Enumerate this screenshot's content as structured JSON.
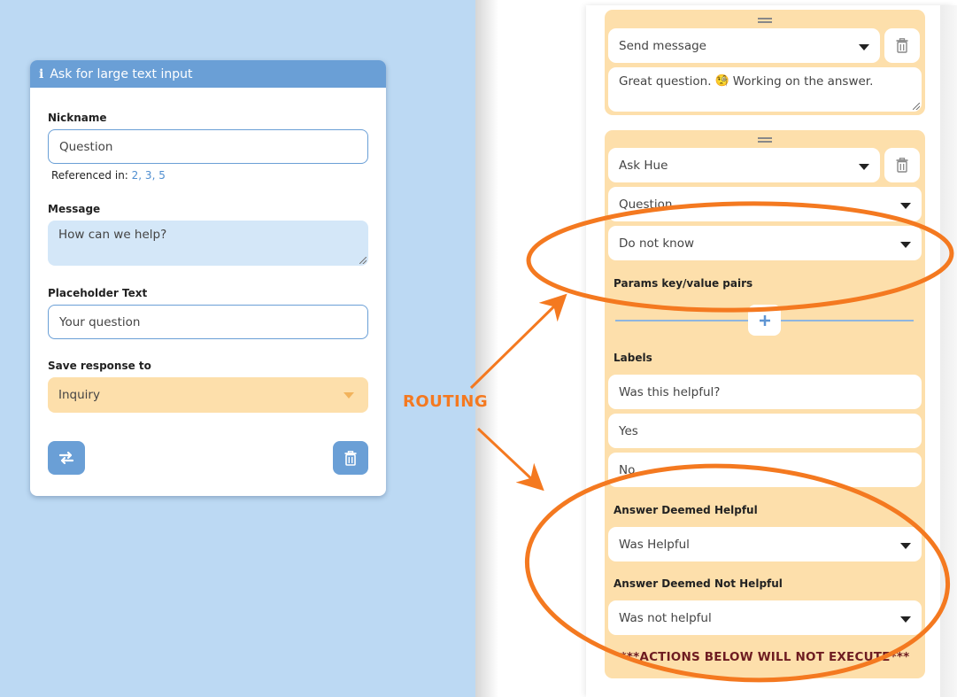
{
  "left_panel": {
    "header": {
      "icon": "info-icon",
      "title": "Ask for large text input"
    },
    "nickname": {
      "label": "Nickname",
      "value": "Question",
      "referenced_in_label": "Referenced in:",
      "referenced_in_values": "2, 3, 5"
    },
    "message": {
      "label": "Message",
      "value": "How can we help?"
    },
    "placeholder_text": {
      "label": "Placeholder Text",
      "value": "Your question"
    },
    "save_response": {
      "label": "Save response to",
      "selected": "Inquiry"
    },
    "buttons": {
      "swap": "swap-arrows-icon",
      "delete": "trash-icon"
    }
  },
  "annotation": {
    "label": "ROUTING",
    "color": "#f47920"
  },
  "right_panel": {
    "send_message_block": {
      "action_select": "Send message",
      "message_text": "Great question.",
      "emoji": "🧐",
      "message_text_after": "Working on the answer."
    },
    "ask_hue_block": {
      "action_select": "Ask Hue",
      "question_select": "Question",
      "fallback_select": "Do not know",
      "params_label": "Params key/value pairs",
      "labels_label": "Labels",
      "labels": [
        "Was this helpful?",
        "Yes",
        "No"
      ],
      "helpful_label": "Answer Deemed Helpful",
      "helpful_select": "Was Helpful",
      "not_helpful_label": "Answer Deemed Not Helpful",
      "not_helpful_select": "Was not helpful",
      "warning": "***ACTIONS BELOW WILL NOT EXECUTE***"
    }
  },
  "colors": {
    "accent_blue": "#6a9fd6",
    "block_orange": "#fddfab",
    "warning_text": "#6e1c21"
  }
}
